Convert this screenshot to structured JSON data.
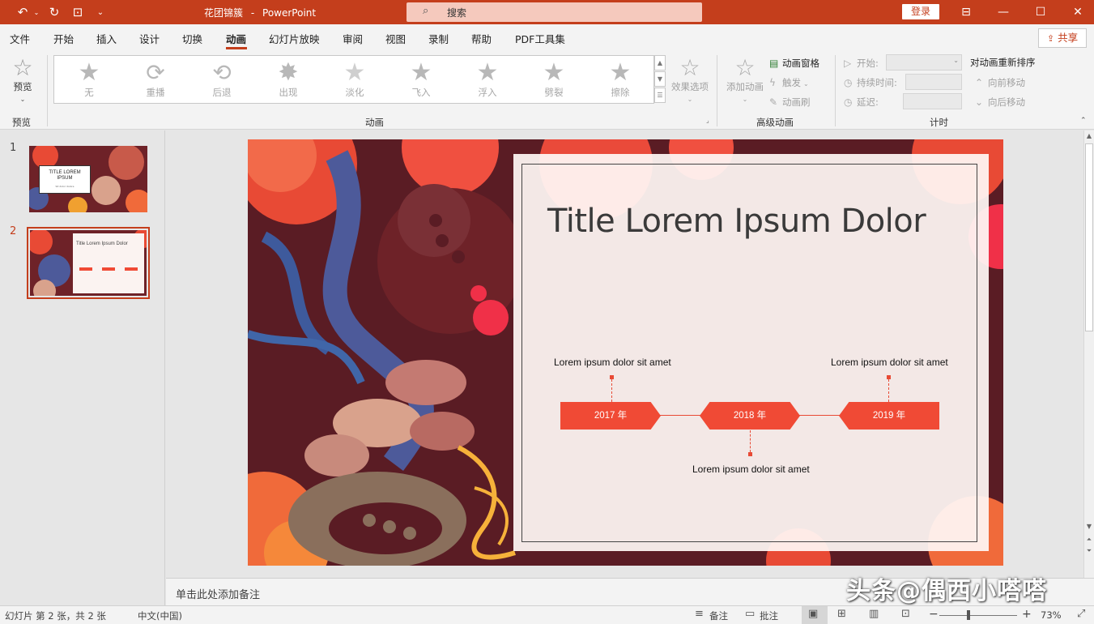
{
  "titlebar": {
    "doc_name": "花团锦簇",
    "separator": "-",
    "app_name": "PowerPoint",
    "search_placeholder": "搜索",
    "login_label": "登录"
  },
  "tabs": [
    {
      "label": "文件"
    },
    {
      "label": "开始"
    },
    {
      "label": "插入"
    },
    {
      "label": "设计"
    },
    {
      "label": "切换"
    },
    {
      "label": "动画",
      "active": true
    },
    {
      "label": "幻灯片放映"
    },
    {
      "label": "审阅"
    },
    {
      "label": "视图"
    },
    {
      "label": "录制"
    },
    {
      "label": "帮助"
    },
    {
      "label": "PDF工具集"
    }
  ],
  "share_label": "共享",
  "ribbon": {
    "preview": {
      "label": "预览",
      "group_label": "预览"
    },
    "animations": {
      "group_label": "动画",
      "items": [
        {
          "label": "无",
          "icon": "star-icon"
        },
        {
          "label": "重播",
          "icon": "replay-icon"
        },
        {
          "label": "后退",
          "icon": "back-icon"
        },
        {
          "label": "出现",
          "icon": "star-burst-icon"
        },
        {
          "label": "淡化",
          "icon": "star-fade-icon"
        },
        {
          "label": "飞入",
          "icon": "star-fly-icon"
        },
        {
          "label": "浮入",
          "icon": "star-float-icon"
        },
        {
          "label": "劈裂",
          "icon": "star-split-icon"
        },
        {
          "label": "擦除",
          "icon": "star-wipe-icon"
        }
      ],
      "effect_options": "效果选项"
    },
    "advanced": {
      "group_label": "高级动画",
      "add_animation": "添加动画",
      "animation_pane": "动画窗格",
      "trigger": "触发",
      "animation_painter": "动画刷"
    },
    "timing": {
      "group_label": "计时",
      "start": "开始:",
      "duration": "持续时间:",
      "delay": "延迟:",
      "reorder_title": "对动画重新排序",
      "move_earlier": "向前移动",
      "move_later": "向后移动"
    }
  },
  "thumbnails": [
    {
      "number": "1",
      "title": "TITLE LOREM IPSUM",
      "subtitle": "Sit dolor dolore"
    },
    {
      "number": "2",
      "title": "Title Lorem Ipsum Dolor",
      "selected": true
    }
  ],
  "slide": {
    "title": "Title Lorem Ipsum Dolor",
    "timeline": [
      {
        "year": "2017 年",
        "caption": "Lorem ipsum dolor sit amet"
      },
      {
        "year": "2018 年",
        "caption": "Lorem ipsum dolor sit amet"
      },
      {
        "year": "2019 年",
        "caption": "Lorem ipsum dolor sit amet"
      }
    ]
  },
  "notes_placeholder": "单击此处添加备注",
  "watermark": "头条@偶西小嗒嗒",
  "statusbar": {
    "slide_info": "幻灯片 第 2 张，共 2 张",
    "language": "中文(中国)",
    "notes": "备注",
    "comments": "批注",
    "zoom_minus": "−",
    "zoom_plus": "+",
    "zoom": "73%"
  },
  "colors": {
    "accent": "#c43e1c",
    "timeline": "#f04a35",
    "slide_bg": "#5a1c24"
  }
}
